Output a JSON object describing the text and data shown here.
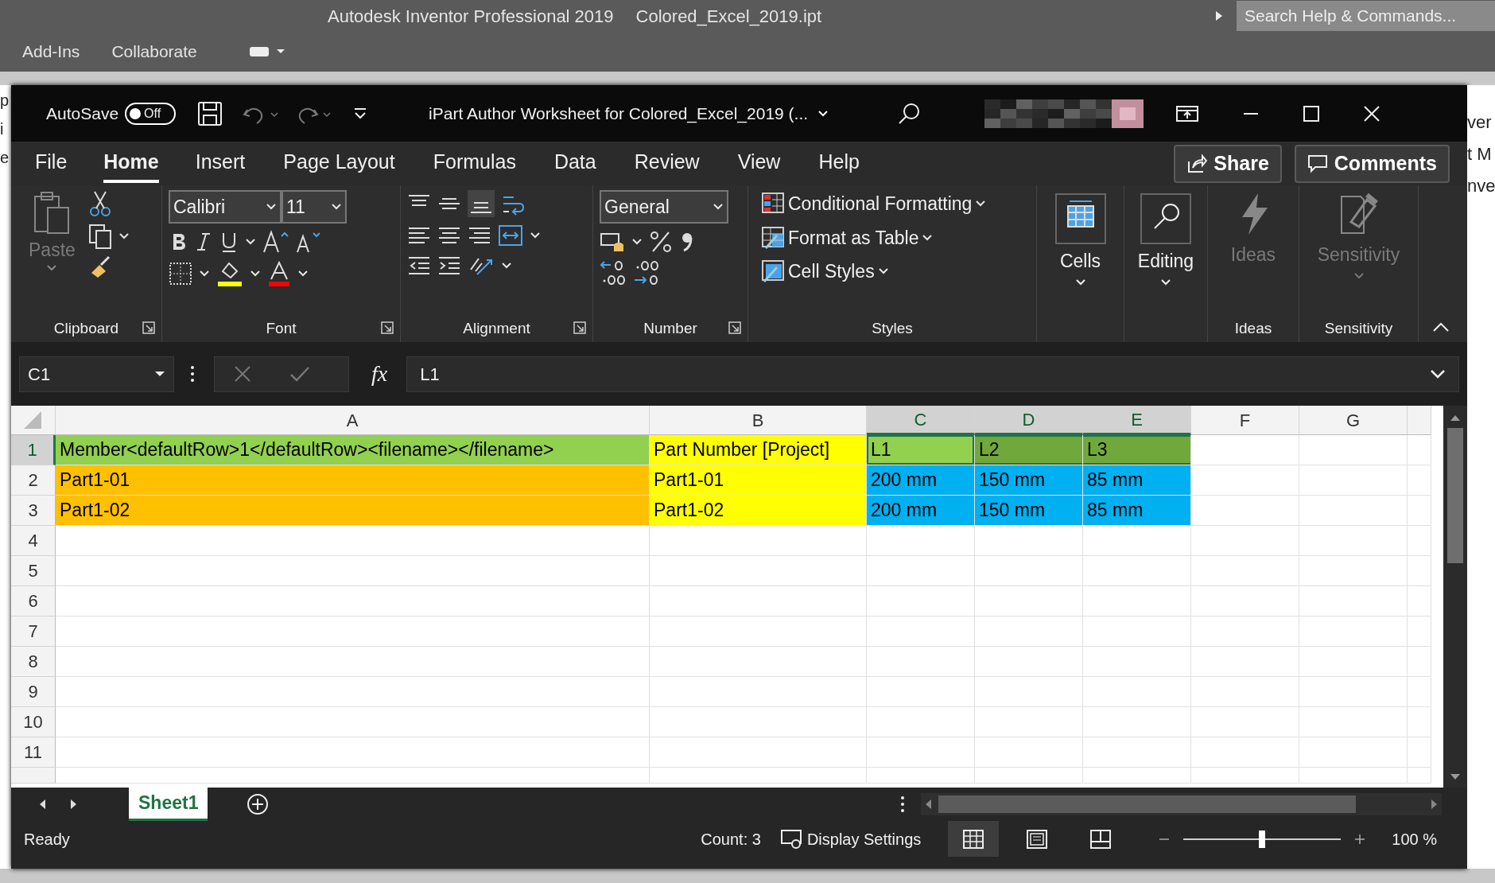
{
  "app_bar": {
    "title": "Autodesk Inventor Professional 2019",
    "document": "Colored_Excel_2019.ipt",
    "search": {
      "placeholder": "Search Help & Commands..."
    },
    "tabs": [
      "Add-Ins",
      "Collaborate"
    ]
  },
  "edge_texts": {
    "left": [
      "p",
      "i",
      "e"
    ],
    "right": [
      "ver",
      "t M",
      "nve"
    ]
  },
  "title_bar": {
    "autosave": {
      "label": "AutoSave",
      "state": "Off",
      "on": false
    },
    "title": "iPart Author Worksheet for Colored_Excel_2019 (..."
  },
  "ribbon_tabs": [
    {
      "label": "File",
      "selected": false
    },
    {
      "label": "Home",
      "selected": true
    },
    {
      "label": "Insert",
      "selected": false
    },
    {
      "label": "Page Layout",
      "selected": false
    },
    {
      "label": "Formulas",
      "selected": false
    },
    {
      "label": "Data",
      "selected": false
    },
    {
      "label": "Review",
      "selected": false
    },
    {
      "label": "View",
      "selected": false
    },
    {
      "label": "Help",
      "selected": false
    }
  ],
  "share": "Share",
  "comments": "Comments",
  "ribbon": [
    {
      "kind": "clipboard",
      "label": "Clipboard",
      "paste": {
        "label": "Paste",
        "disabled": true
      }
    },
    {
      "kind": "font",
      "label": "Font",
      "font": "Calibri",
      "size": "11"
    },
    {
      "kind": "alignment",
      "label": "Alignment"
    },
    {
      "kind": "number",
      "label": "Number",
      "format": "General"
    },
    {
      "kind": "styles",
      "label": "Styles",
      "items": [
        "Conditional Formatting",
        "Format as Table",
        "Cell Styles"
      ]
    },
    {
      "kind": "cells",
      "button": "Cells",
      "disabled": false
    },
    {
      "kind": "editing",
      "button": "Editing",
      "disabled": false
    },
    {
      "kind": "ideas",
      "label": "Ideas",
      "button": "Ideas",
      "disabled": true
    },
    {
      "kind": "sensitivity",
      "label": "Sensitivity",
      "button": "Sensitivity",
      "disabled": true
    }
  ],
  "formula_bar": {
    "name_box": "C1",
    "fx": "fx",
    "formula": "L1"
  },
  "columns": [
    {
      "label": "A",
      "selected": false
    },
    {
      "label": "B",
      "selected": false
    },
    {
      "label": "C",
      "selected": true
    },
    {
      "label": "D",
      "selected": true
    },
    {
      "label": "E",
      "selected": true
    },
    {
      "label": "F",
      "selected": false
    },
    {
      "label": "G",
      "selected": false
    }
  ],
  "rows": [
    {
      "number": "1",
      "selected": true,
      "cells": [
        {
          "text": "Member<defaultRow>1</defaultRow><filename></filename>",
          "color": "#92d050",
          "selected": false
        },
        {
          "text": "Part Number [Project]",
          "color": "#ffff00",
          "selected": false
        },
        {
          "text": "L1",
          "color": "#92d050",
          "selected": true
        },
        {
          "text": "L2",
          "color": "#70a83c",
          "selected": true
        },
        {
          "text": "L3",
          "color": "#70a83c",
          "selected": true
        }
      ]
    },
    {
      "number": "2",
      "selected": false,
      "cells": [
        {
          "text": "Part1-01",
          "color": "#ffc000",
          "selected": false
        },
        {
          "text": "Part1-01",
          "color": "#ffff00",
          "selected": false
        },
        {
          "text": "200 mm",
          "color": "#00b0f0",
          "selected": false
        },
        {
          "text": "150 mm",
          "color": "#00b0f0",
          "selected": false
        },
        {
          "text": "85 mm",
          "color": "#00b0f0",
          "selected": false
        }
      ]
    },
    {
      "number": "3",
      "selected": false,
      "cells": [
        {
          "text": "Part1-02",
          "color": "#ffc000",
          "selected": false
        },
        {
          "text": "Part1-02",
          "color": "#ffff00",
          "selected": false
        },
        {
          "text": "200 mm",
          "color": "#00b0f0",
          "selected": false
        },
        {
          "text": "150 mm",
          "color": "#00b0f0",
          "selected": false
        },
        {
          "text": "85 mm",
          "color": "#00b0f0",
          "selected": false
        }
      ]
    },
    {
      "number": "4",
      "selected": false
    },
    {
      "number": "5",
      "selected": false
    },
    {
      "number": "6",
      "selected": false
    },
    {
      "number": "7",
      "selected": false
    },
    {
      "number": "8",
      "selected": false
    },
    {
      "number": "9",
      "selected": false
    },
    {
      "number": "10",
      "selected": false
    },
    {
      "number": "11",
      "selected": false
    }
  ],
  "sheets": [
    {
      "label": "Sheet1",
      "selected": true
    }
  ],
  "status_bar": {
    "status": "Ready",
    "count": "Count: 3",
    "display_settings": "Display Settings",
    "views": [
      {
        "kind": "normal",
        "selected": true
      },
      {
        "kind": "page-layout",
        "selected": false
      },
      {
        "kind": "page-break",
        "selected": false
      }
    ],
    "zoom": {
      "level": 0.5,
      "reading": "100 %"
    }
  }
}
